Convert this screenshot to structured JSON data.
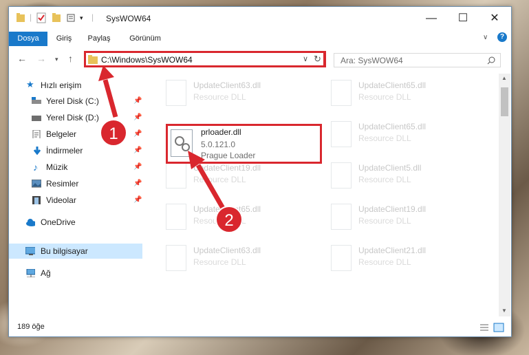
{
  "window": {
    "title": "SysWOW64",
    "minimize_icon": "minimize-icon",
    "maximize_icon": "maximize-icon",
    "close_icon": "close-icon"
  },
  "ribbon": {
    "tabs": [
      "Dosya",
      "Giriş",
      "Paylaş",
      "Görünüm"
    ],
    "active_tab": "Dosya"
  },
  "nav": {
    "address": "C:\\Windows\\SysWOW64",
    "search_placeholder": "Ara: SysWOW64"
  },
  "sidebar": {
    "quick_access": "Hızlı erişim",
    "items": [
      {
        "label": "Yerel Disk (C:)",
        "icon": "drive-icon"
      },
      {
        "label": "Yerel Disk (D:)",
        "icon": "drive-icon"
      },
      {
        "label": "Belgeler",
        "icon": "documents-icon"
      },
      {
        "label": "İndirmeler",
        "icon": "downloads-icon"
      },
      {
        "label": "Müzik",
        "icon": "music-icon"
      },
      {
        "label": "Resimler",
        "icon": "pictures-icon"
      },
      {
        "label": "Videolar",
        "icon": "videos-icon"
      }
    ],
    "onedrive": "OneDrive",
    "this_pc": "Bu bilgisayar",
    "network": "Ağ"
  },
  "files": [
    {
      "name": "UpdateClient63.dll",
      "desc": "Resource DLL"
    },
    {
      "name": "UpdateClient65.dll",
      "desc": "Resource DLL"
    },
    {
      "name": "UpdateClient65.dll",
      "desc": "Resource DLL"
    },
    {
      "name": "UpdateClient19.dll",
      "desc": "Resource DLL"
    },
    {
      "name": "UpdateClient5.dll",
      "desc": "Resource DLL"
    },
    {
      "name": "UpdateClient65.dll",
      "desc": "Resource DLL"
    },
    {
      "name": "UpdateClient19.dll",
      "desc": "Resource DLL"
    },
    {
      "name": "UpdateClient63.dll",
      "desc": "Resource DLL"
    },
    {
      "name": "UpdateClient21.dll",
      "desc": "Resource DLL"
    }
  ],
  "highlighted_file": {
    "name": "prloader.dll",
    "version": "5.0.121.0",
    "description": "Prague Loader"
  },
  "status": {
    "count": "189 öğe"
  },
  "badges": [
    "1",
    "2"
  ],
  "colors": {
    "accent": "#1979ca",
    "highlight": "#d9272e",
    "selected": "#cce8ff"
  }
}
